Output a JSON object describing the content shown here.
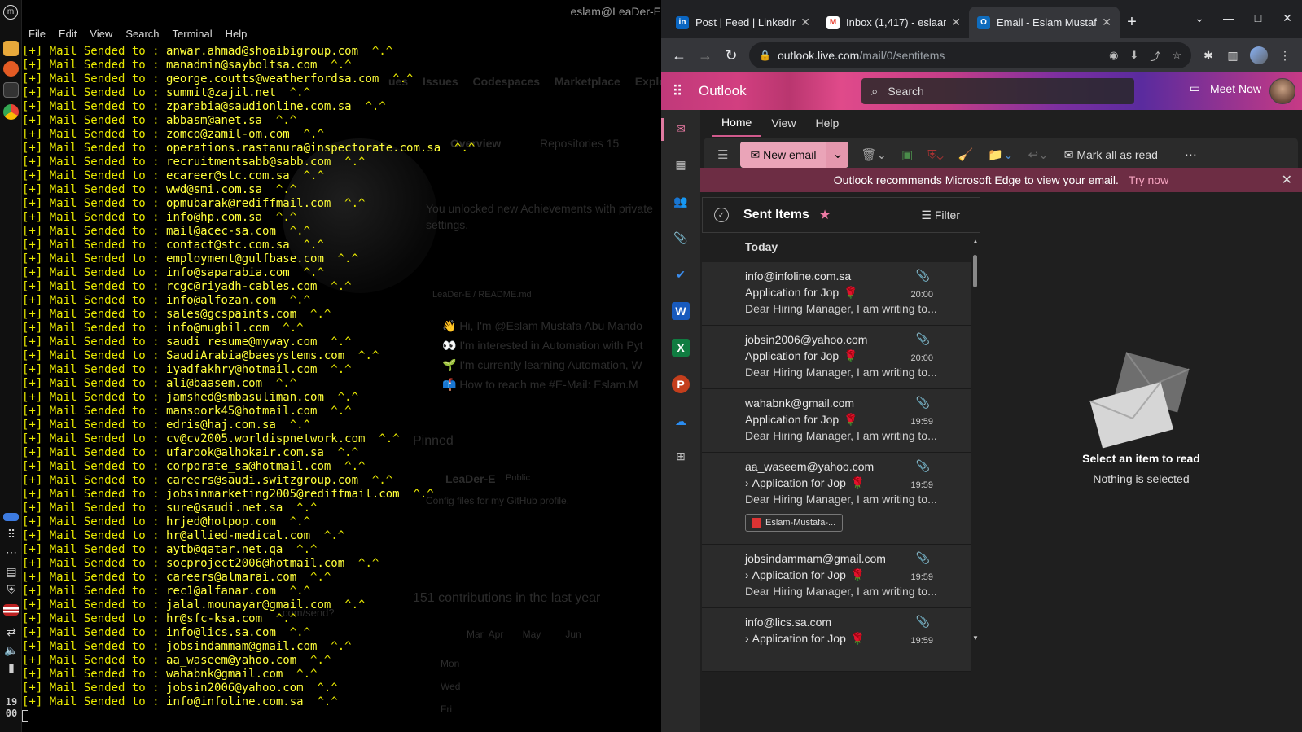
{
  "terminal": {
    "title": "eslam@LeaDer-E",
    "menu": [
      "File",
      "Edit",
      "View",
      "Search",
      "Terminal",
      "Help"
    ],
    "prefix": "[+] Mail Sended to : ",
    "suffix": "  ^.^",
    "emails": [
      "anwar.ahmad@shoaibigroup.com",
      "manadmin@sayboltsa.com",
      "george.coutts@weatherfordsa.com",
      "summit@zajil.net",
      "zparabia@saudionline.com.sa",
      "abbasm@anet.sa",
      "zomco@zamil-om.com",
      "operations.rastanura@inspectorate.com.sa",
      "recruitmentsabb@sabb.com",
      "ecareer@stc.com.sa",
      "wwd@smi.com.sa",
      "opmubarak@rediffmail.com",
      "info@hp.com.sa",
      "mail@acec-sa.com",
      "contact@stc.com.sa",
      "employment@gulfbase.com",
      "info@saparabia.com",
      "rcgc@riyadh-cables.com",
      "info@alfozan.com",
      "sales@gcspaints.com",
      "info@mugbil.com",
      "saudi_resume@myway.com",
      "SaudiArabia@baesystems.com",
      "iyadfakhry@hotmail.com",
      "ali@baasem.com",
      "jamshed@smbasuliman.com",
      "mansoork45@hotmail.com",
      "edris@haj.com.sa",
      "cv@cv2005.worldispnetwork.com",
      "ufarook@alhokair.com.sa",
      "corporate_sa@hotmail.com",
      "careers@saudi.switzgroup.com",
      "jobsinmarketing2005@rediffmail.com",
      "sure@saudi.net.sa",
      "hrjed@hotpop.com",
      "hr@allied-medical.com",
      "aytb@qatar.net.qa",
      "socproject2006@hotmail.com",
      "careers@almarai.com",
      "rec1@alfanar.com",
      "jalal.mounayar@gmail.com",
      "hr@sfc-ksa.com",
      "info@lics.sa.com",
      "jobsindammam@gmail.com",
      "aa_waseem@yahoo.com",
      "wahabnk@gmail.com",
      "jobsin2006@yahoo.com",
      "info@infoline.com.sa"
    ],
    "ghost_text": {
      "nav": [
        "ues",
        "Issues",
        "Codespaces",
        "Marketplace",
        "Explore"
      ],
      "overview": "Overview",
      "repositories": "Repositories",
      "repo_count": "15",
      "achievements": "You unlocked new Achievements with private",
      "settings": "settings.",
      "readme": "LeaDer-E / README.md",
      "bullets": [
        "👋 Hi, I'm @Eslam Mustafa Abu Mando",
        "👀 I'm interested in Automation with Pyt",
        "🌱 I'm currently learning Automation, W",
        "📫 How to reach me #E-Mail: Eslam.M"
      ],
      "pinned": "Pinned",
      "repo_name": "LeaDer-E",
      "public": "Public",
      "config": "Config files for my GitHub profile.",
      "contrib": "151 contributions in the last year",
      "months": "Mar  Apr       May         Jun",
      "days": [
        "Mon",
        "Wed",
        "Fri"
      ],
      "url_hint": "com/send?"
    }
  },
  "clock": {
    "h": "19",
    "m": "00"
  },
  "browser": {
    "tabs": [
      {
        "label": "Post | Feed | LinkedIn",
        "icon": "linkedin-icon",
        "color": "#0a66c2",
        "glyph": "in"
      },
      {
        "label": "Inbox (1,417) - eslaam",
        "icon": "gmail-icon",
        "color": "#ea4335",
        "glyph": "M"
      },
      {
        "label": "Email - Eslam Mustaf",
        "icon": "outlook-icon",
        "color": "#0f6cbd",
        "glyph": "O"
      }
    ],
    "url_host": "outlook.live.com",
    "url_path": "/mail/0/sentitems"
  },
  "outlook": {
    "brand": "Outlook",
    "search_placeholder": "Search",
    "meet_now": "Meet Now",
    "ribbon_tabs": [
      "Home",
      "View",
      "Help"
    ],
    "new_email": "New email",
    "mark_all_read": "Mark all as read",
    "banner_text": "Outlook recommends Microsoft Edge to view your email.",
    "banner_link": "Try now",
    "folder": "Sent Items",
    "filter": "Filter",
    "section": "Today",
    "messages": [
      {
        "from": "info@infoline.com.sa",
        "subject": "Application for Jop",
        "time": "20:00",
        "preview": "Dear Hiring Manager, I am writing to...",
        "thread": false
      },
      {
        "from": "jobsin2006@yahoo.com",
        "subject": "Application for Jop",
        "time": "20:00",
        "preview": "Dear Hiring Manager, I am writing to...",
        "thread": false
      },
      {
        "from": "wahabnk@gmail.com",
        "subject": "Application for Jop",
        "time": "19:59",
        "preview": "Dear Hiring Manager, I am writing to...",
        "thread": false
      },
      {
        "from": "aa_waseem@yahoo.com",
        "subject": "Application for Jop",
        "time": "19:59",
        "preview": "Dear Hiring Manager, I am writing to...",
        "thread": true,
        "attachment": "Eslam-Mustafa-..."
      },
      {
        "from": "jobsindammam@gmail.com",
        "subject": "Application for Jop",
        "time": "19:59",
        "preview": "Dear Hiring Manager, I am writing to...",
        "thread": true
      },
      {
        "from": "info@lics.sa.com",
        "subject": "Application for Jop",
        "time": "19:59",
        "preview": "",
        "thread": true
      }
    ],
    "select_title": "Select an item to read",
    "select_sub": "Nothing is selected"
  }
}
